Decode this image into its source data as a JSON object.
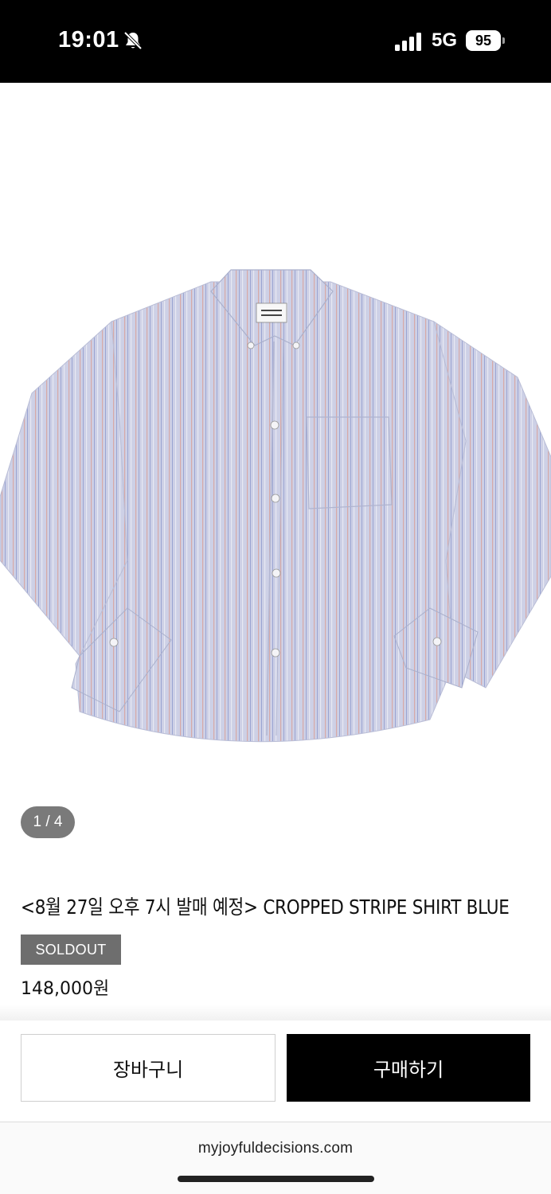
{
  "status_bar": {
    "time": "19:01",
    "network": "5G",
    "battery": "95",
    "icons": [
      "bell-slash-icon",
      "signal-icon",
      "battery-icon"
    ]
  },
  "product": {
    "image_alt": "cropped stripe shirt",
    "page_indicator": "1 / 4",
    "title": "<8월 27일 오후 7시 발매 예정> CROPPED STRIPE SHIRT BLUE",
    "badge": "SOLDOUT",
    "price": "148,000원"
  },
  "actions": {
    "cart_label": "장바구니",
    "buy_label": "구매하기"
  },
  "browser": {
    "url": "myjoyfuldecisions.com"
  },
  "colors": {
    "status_bar_bg": "#000000",
    "buy_button_bg": "#000000",
    "badge_bg": "#6e6e6e",
    "shirt_base": "#c9cbe2"
  }
}
